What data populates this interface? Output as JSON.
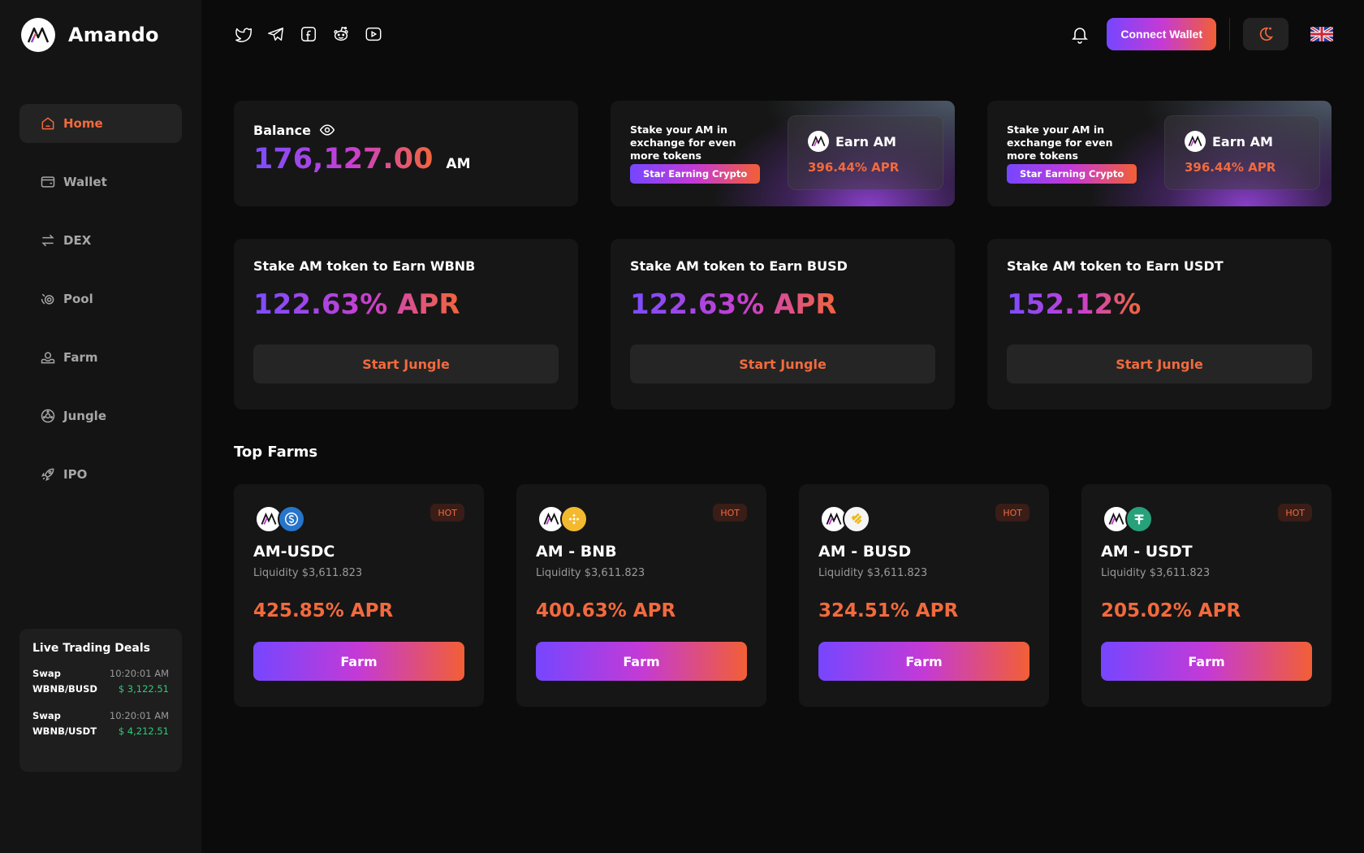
{
  "brand": {
    "name": "Amando"
  },
  "colors": {
    "accent": "#f26a3d",
    "gradient_start": "#7646ff",
    "gradient_mid": "#c43ad6",
    "gradient_end": "#f25f35",
    "positive": "#2fcb7a",
    "background": "#0b0b0b",
    "card": "#161616"
  },
  "sidebar": {
    "items": [
      {
        "label": "Home",
        "icon": "home-icon",
        "active": true
      },
      {
        "label": "Wallet",
        "icon": "wallet-icon",
        "active": false
      },
      {
        "label": "DEX",
        "icon": "swap-arrows-icon",
        "active": false
      },
      {
        "label": "Pool",
        "icon": "pool-icon",
        "active": false
      },
      {
        "label": "Farm",
        "icon": "farm-icon",
        "active": false
      },
      {
        "label": "Jungle",
        "icon": "jungle-icon",
        "active": false
      },
      {
        "label": "IPO",
        "icon": "rocket-icon",
        "active": false
      }
    ],
    "live": {
      "title": "Live Trading Deals",
      "deals": [
        {
          "type": "Swap",
          "time": "10:20:01 AM",
          "pair": "WBNB/BUSD",
          "amount": "$ 3,122.51"
        },
        {
          "type": "Swap",
          "time": "10:20:01 AM",
          "pair": "WBNB/USDT",
          "amount": "$ 4,212.51"
        }
      ]
    }
  },
  "header": {
    "social": [
      "twitter-icon",
      "telegram-icon",
      "facebook-icon",
      "reddit-icon",
      "youtube-icon"
    ],
    "connect_label": "Connect Wallet",
    "theme_icon": "moon-sun-icon",
    "language_icon": "uk-flag-icon"
  },
  "balance": {
    "label": "Balance",
    "value": "176,127.00",
    "unit": "AM"
  },
  "promos": [
    {
      "text": "Stake your AM in exchange for even more tokens",
      "button": "Star Earning Crypto",
      "earn_title": "Earn AM",
      "apr": "396.44% APR"
    },
    {
      "text": "Stake your AM in exchange for even more tokens",
      "button": "Star Earning Crypto",
      "earn_title": "Earn AM",
      "apr": "396.44% APR"
    }
  ],
  "stakes": [
    {
      "title": "Stake AM token to Earn WBNB",
      "apr": "122.63% APR",
      "button": "Start Jungle"
    },
    {
      "title": "Stake AM token to Earn BUSD",
      "apr": "122.63% APR",
      "button": "Start Jungle"
    },
    {
      "title": "Stake AM token to Earn USDT",
      "apr": "152.12%",
      "button": "Start Jungle"
    }
  ],
  "top_farms": {
    "title": "Top Farms",
    "farms": [
      {
        "name": "AM-USDC",
        "liquidity": "Liquidity $3,611.823",
        "apr": "425.85% APR",
        "badge": "HOT",
        "button": "Farm",
        "coin": "usdc-icon",
        "coin_color": "#2775ca"
      },
      {
        "name": "AM - BNB",
        "liquidity": "Liquidity $3,611.823",
        "apr": "400.63% APR",
        "badge": "HOT",
        "button": "Farm",
        "coin": "bnb-icon",
        "coin_color": "#f3ba2f"
      },
      {
        "name": "AM - BUSD",
        "liquidity": "Liquidity $3,611.823",
        "apr": "324.51% APR",
        "badge": "HOT",
        "button": "Farm",
        "coin": "busd-icon",
        "coin_color": "#f0b90b"
      },
      {
        "name": "AM - USDT",
        "liquidity": "Liquidity $3,611.823",
        "apr": "205.02% APR",
        "badge": "HOT",
        "button": "Farm",
        "coin": "usdt-icon",
        "coin_color": "#26a17b"
      }
    ]
  }
}
